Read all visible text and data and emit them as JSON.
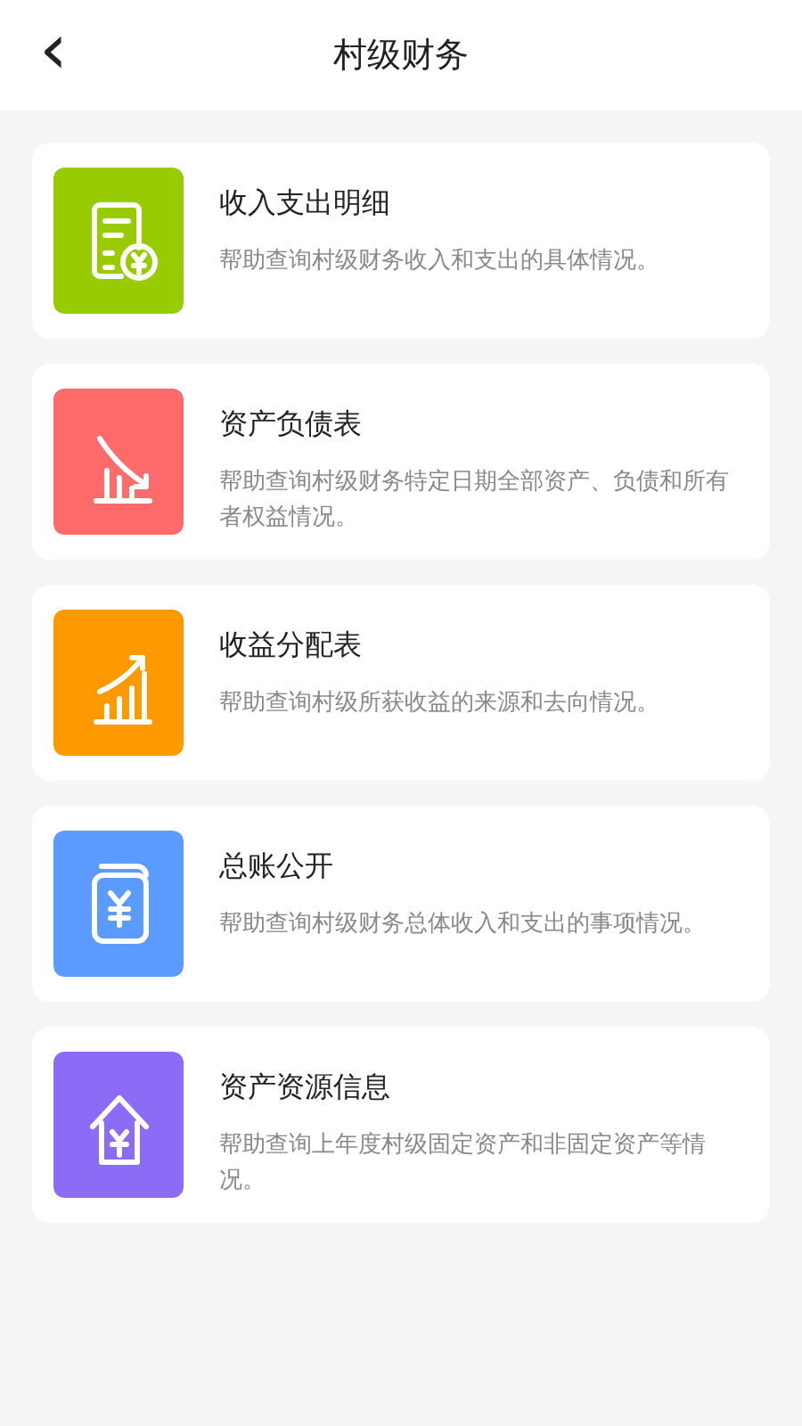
{
  "header": {
    "back_icon": "‹",
    "title": "村级财务"
  },
  "items": [
    {
      "kind": "ledger",
      "color": "#99cc00",
      "title": "收入支出明细",
      "description": "帮助查询村级财务收入和支出的具体情况。"
    },
    {
      "kind": "decline",
      "color": "#ff6b6b",
      "title": "资产负债表",
      "description": "帮助查询村级财务特定日期全部资产、负债和所有者权益情况。"
    },
    {
      "kind": "growth",
      "color": "#ff9900",
      "title": "收益分配表",
      "description": "帮助查询村级所获收益的来源和去向情况。"
    },
    {
      "kind": "wallet",
      "color": "#5b9bff",
      "title": "总账公开",
      "description": "帮助查询村级财务总体收入和支出的事项情况。"
    },
    {
      "kind": "house",
      "color": "#8c6cf7",
      "title": "资产资源信息",
      "description": "帮助查询上年度村级固定资产和非固定资产等情况。"
    }
  ]
}
